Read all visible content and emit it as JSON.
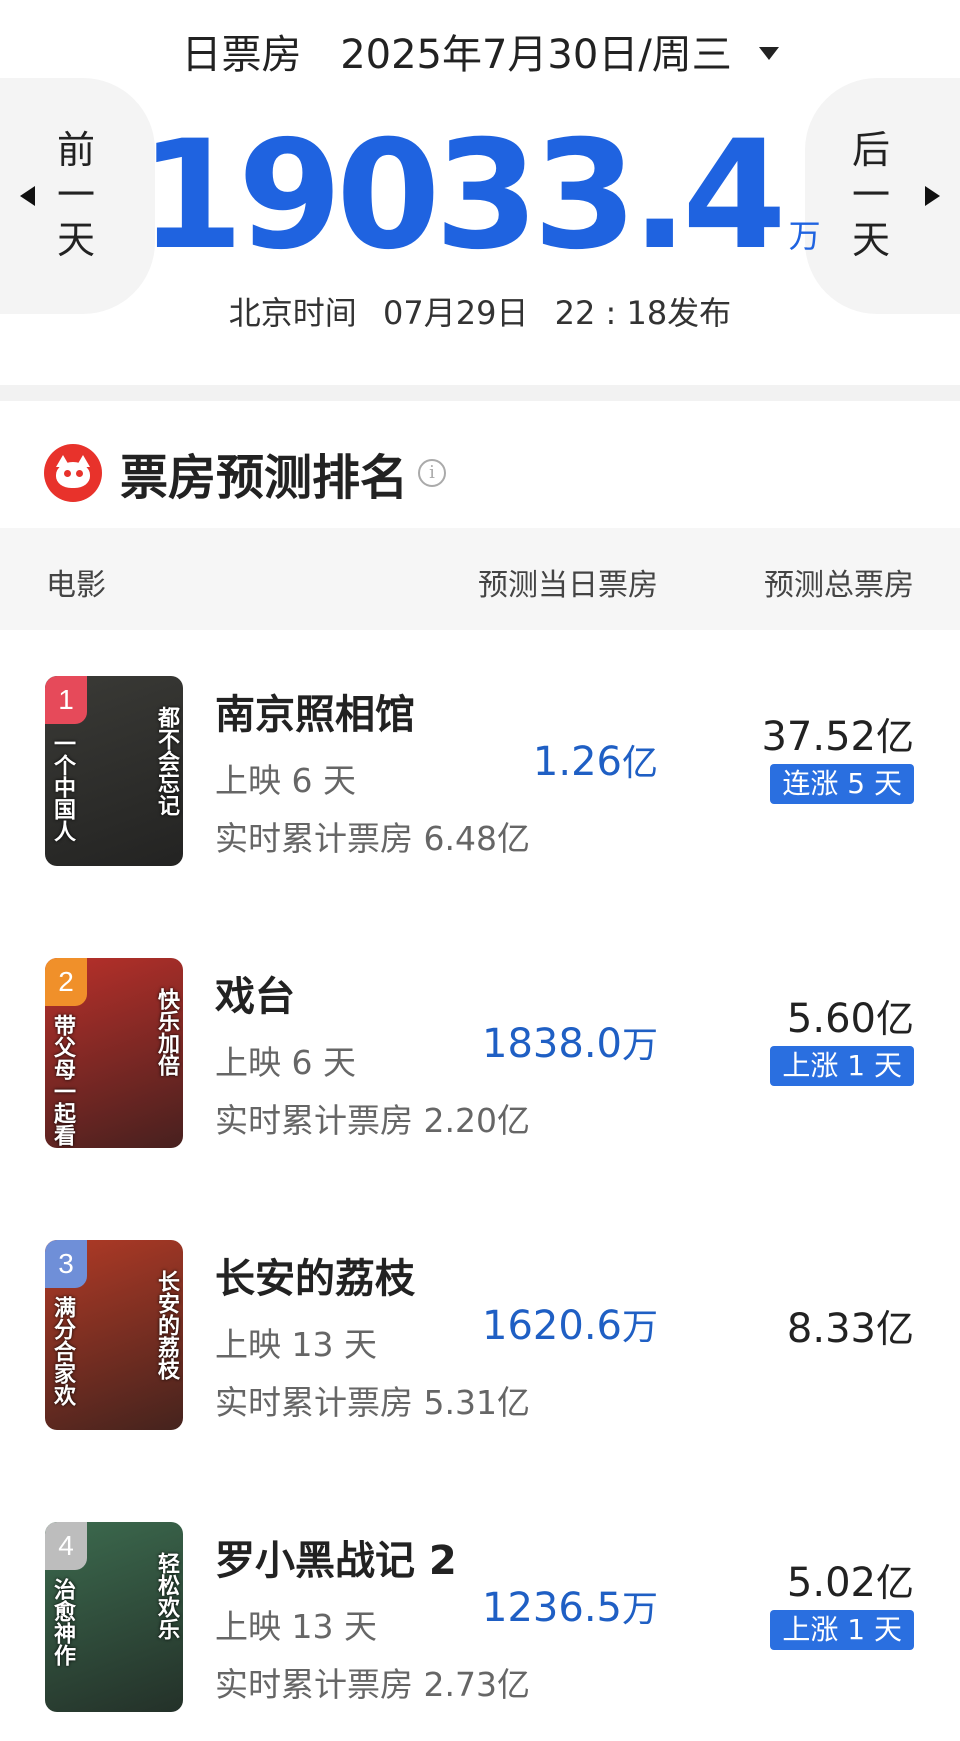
{
  "header": {
    "label": "日票房",
    "date": "2025年7月30日/周三",
    "prev_label": "前一天",
    "next_label": "后一天",
    "total_value": "19033.4",
    "total_unit": "万",
    "release_prefix": "北京时间",
    "release_date": "07月29日",
    "release_time": "22 : 18发布"
  },
  "section": {
    "title": "票房预测排名",
    "info_icon": "i"
  },
  "table_header": {
    "movie": "电影",
    "daily": "预测当日票房",
    "total": "预测总票房"
  },
  "rows": [
    {
      "rank": "1",
      "rank_color": "#e64a5a",
      "title": "南京照相馆",
      "days": "上映 6 天",
      "cumulative": "实时累计票房 6.48亿",
      "daily_value": "1.26",
      "daily_unit": "亿",
      "total_value": "37.52",
      "total_unit": "亿",
      "tag": "连涨 5 天",
      "poster_bg": "#3a3a36",
      "poster_left": "一个中国人",
      "poster_right": "都不会忘记"
    },
    {
      "rank": "2",
      "rank_color": "#f0902a",
      "title": "戏台",
      "days": "上映 6 天",
      "cumulative": "实时累计票房 2.20亿",
      "daily_value": "1838.0",
      "daily_unit": "万",
      "total_value": "5.60",
      "total_unit": "亿",
      "tag": "上涨 1 天",
      "poster_bg": "#b8302a",
      "poster_left": "带父母一起看",
      "poster_right": "快乐加倍"
    },
    {
      "rank": "3",
      "rank_color": "#6f8fd8",
      "title": "长安的荔枝",
      "days": "上映 13 天",
      "cumulative": "实时累计票房 5.31亿",
      "daily_value": "1620.6",
      "daily_unit": "万",
      "total_value": "8.33",
      "total_unit": "亿",
      "tag": "",
      "poster_bg": "#b03a26",
      "poster_left": "满分合家欢",
      "poster_right": "长安的荔枝"
    },
    {
      "rank": "4",
      "rank_color": "#bdbdbd",
      "title": "罗小黑战记 2",
      "days": "上映 13 天",
      "cumulative": "实时累计票房 2.73亿",
      "daily_value": "1236.5",
      "daily_unit": "万",
      "total_value": "5.02",
      "total_unit": "亿",
      "tag": "上涨 1 天",
      "poster_bg": "#3c6a4e",
      "poster_left": "治愈神作",
      "poster_right": "轻松欢乐"
    }
  ]
}
